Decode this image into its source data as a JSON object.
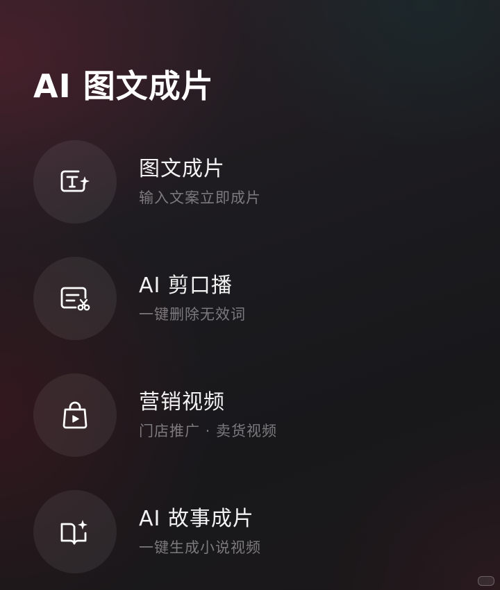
{
  "header": {
    "title": "AI 图文成片"
  },
  "menu": {
    "items": [
      {
        "title": "图文成片",
        "subtitle": "输入文案立即成片",
        "icon": "text-to-video-icon"
      },
      {
        "title": "AI 剪口播",
        "subtitle": "一键删除无效词",
        "icon": "script-cut-icon"
      },
      {
        "title": "营销视频",
        "subtitle": "门店推广 · 卖货视频",
        "icon": "shopping-bag-play-icon"
      },
      {
        "title": "AI 故事成片",
        "subtitle": "一键生成小说视频",
        "icon": "book-sparkle-icon"
      }
    ]
  },
  "colors": {
    "title": "#ffffff",
    "item_title": "#f2f2f2",
    "item_subtitle": "#7c7a7d",
    "icon_stroke": "#ffffff"
  }
}
